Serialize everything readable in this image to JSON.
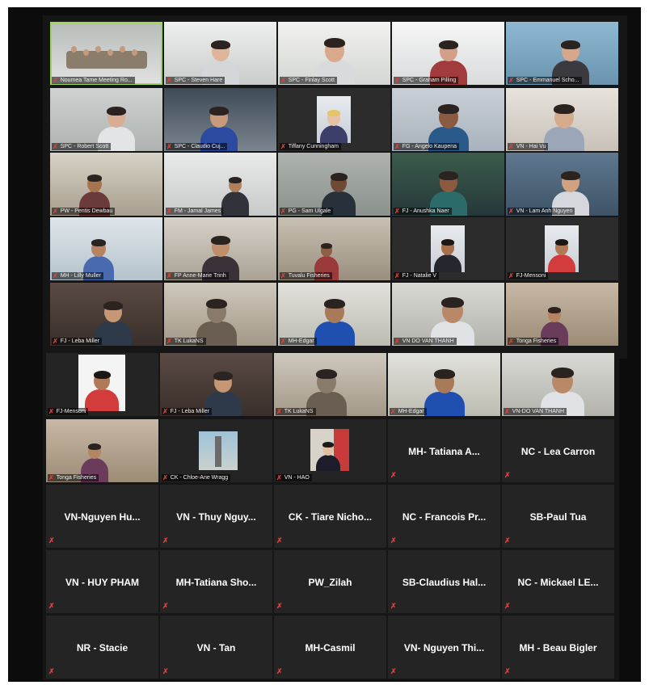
{
  "app": {
    "window_title": ""
  },
  "meeting": {
    "grid_a": [
      "Noumea Tame Meeting Ro...",
      "SPC - Steven Hare",
      "SPC - Finlay Scott",
      "SPC - Graham Pilling",
      "SPC - Emmanuel Scho...",
      "SPC - Robert Scott",
      "SPC - Claudio Cuj...",
      "Tiffany Cunningham",
      "FG - Angelo Kaupena",
      "VN - Hai Vu",
      "PW - Pentis Dewbau",
      "FM - Jamal James",
      "PG - Sam Ulgale",
      "FJ - Anushka Naer",
      "VN - Lam Anh Nguyen",
      "MH - Lilly Muller",
      "FP Anne-Marie Trinh",
      "Tuvalu Fisheries",
      "FJ - Natalie V",
      "FJ-Mensoni",
      "FJ - Leba Miller",
      "TK LukaNS",
      "MH-Edgar",
      "VN DO VAN THANH",
      "Tonga Fisheries"
    ],
    "grid_b_video": [
      "FJ-Mensoni",
      "FJ - Leba Miller",
      "TK LukaNS",
      "MH-Edgar",
      "VN-DO VAN THANH",
      "Tonga Fisheries",
      "CK - Chloe-Ane Wragg",
      "VN - HAO"
    ],
    "grid_b_names": [
      "MH- Tatiana A...",
      "NC - Lea Carron",
      "VN-Nguyen Hu...",
      "VN - Thuy Nguy...",
      "CK - Tiare Nicho...",
      "NC - Francois Pr...",
      "SB-Paul Tua",
      "VN - HUY PHAM",
      "MH-Tatiana Sho...",
      "PW_Zilah",
      "SB-Claudius Hal...",
      "NC - Mickael LE...",
      "NR - Stacie",
      "VN - Tan",
      "MH-Casmil",
      "VN- Nguyen Thi...",
      "MH - Beau Bigler"
    ]
  },
  "icons": {
    "muted": "muted-mic-icon",
    "muted_glyph": "✗"
  },
  "colors": {
    "active_speaker": "#9fd65a",
    "muted_icon": "#e0403a",
    "tile_bg": "#242424"
  }
}
